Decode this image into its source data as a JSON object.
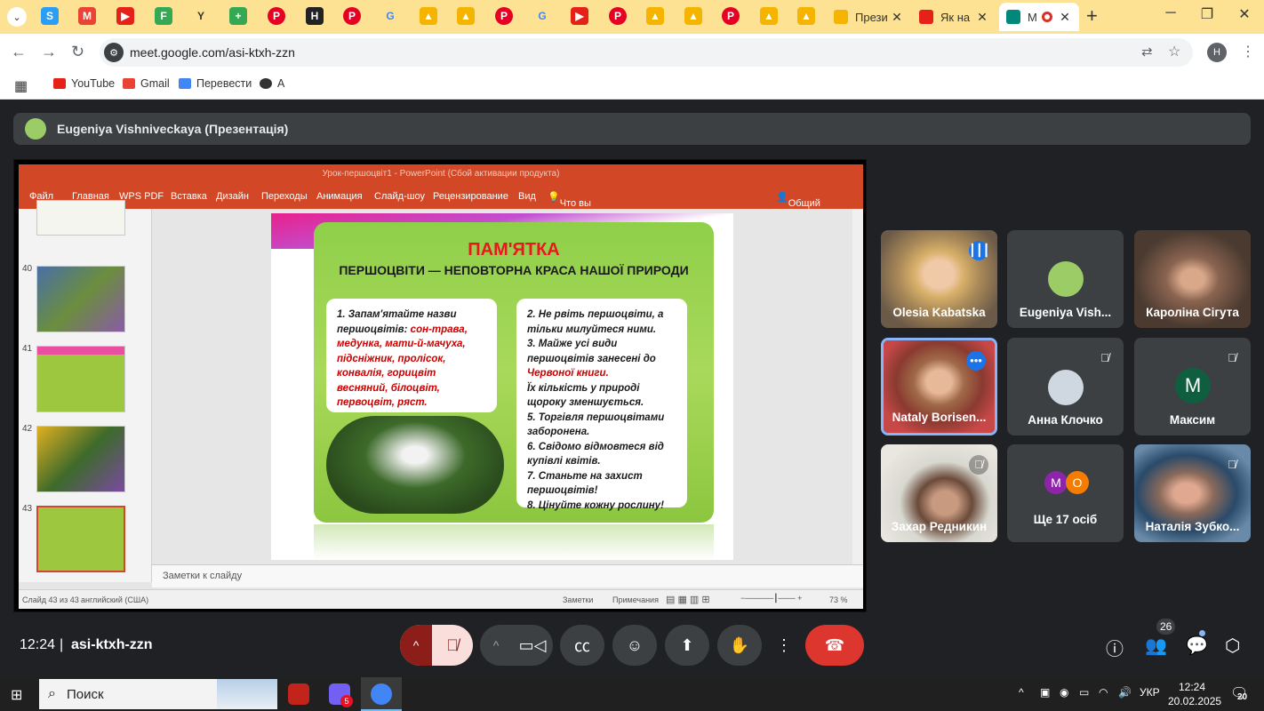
{
  "browser": {
    "tabs": [
      {
        "label": "Прези",
        "close": "✕"
      },
      {
        "label": "Як на",
        "close": "✕"
      },
      {
        "label": "M",
        "close": "✕"
      }
    ],
    "new_tab": "+",
    "url": "meet.google.com/asi-ktxh-zzn",
    "profile_initial": "H",
    "bookmarks": [
      "YouTube",
      "Gmail",
      "Перевести",
      "A"
    ]
  },
  "meet": {
    "presenter_label": "Eugeniya Vishniveckaya (Презентація)",
    "meeting_time": "12:24",
    "meeting_code": "asi-ktxh-zzn",
    "participants_count": "26",
    "participants": [
      {
        "name": "Olesia Kabatska",
        "muted": false,
        "speaking": true
      },
      {
        "name": "Eugeniya Vish...",
        "muted": false
      },
      {
        "name": "Кароліна Сігута",
        "muted": false
      },
      {
        "name": "Nataly Borisen...",
        "muted": false,
        "active": true
      },
      {
        "name": "Анна Клочко",
        "muted": true
      },
      {
        "name": "Максим",
        "muted": true,
        "initial": "M"
      },
      {
        "name": "Захар Редникин",
        "muted": true
      },
      {
        "name": "Ще 17 осіб",
        "initials": [
          "M",
          "O"
        ]
      },
      {
        "name": "Наталія Зубко...",
        "muted": true
      }
    ]
  },
  "ppt": {
    "title": "Урок-першоцвіт1 - PowerPoint (Сбой активации продукта)",
    "menu": [
      "Файл",
      "Главная",
      "WPS PDF",
      "Вставка",
      "Дизайн",
      "Переходы",
      "Анимация",
      "Слайд-шоу",
      "Рецензирование",
      "Вид",
      "Что вы хотите сделать?",
      "Общий доступ"
    ],
    "slide_numbers": [
      "40",
      "41",
      "42",
      "43"
    ],
    "notes_placeholder": "Заметки к слайду",
    "status_left": "Слайд 43 из 43",
    "status_lang": "английский (США)",
    "status_notes": "Заметки",
    "status_comments": "Примечания",
    "zoom": "73 %",
    "slide": {
      "title": "ПАМ'ЯТКА",
      "subtitle": "ПЕРШОЦВІТИ — НЕПОВТОРНА КРАСА НАШОЇ ПРИРОДИ",
      "left_intro": "1. Запам'ятайте назви першоцвітів:",
      "left_list": "сон-трава, медунка, мати-й-мачуха, підсніжник, пролісок, конвалія, горицвіт весняний, білоцвіт, первоцвіт, ряст.",
      "right_items": [
        "2. Не рвіть першоцвіти, а тільки милуйтеся ними.",
        "3. Майже усі види першоцвітів занесені до",
        "Червоної книги.",
        "Їх кількість у природі щороку зменшується.",
        "5. Торгівля першоцвітами заборонена.",
        "6. Свідомо відмовтеся від купівлі квітів.",
        "7. Станьте на захист першоцвітів!",
        "8. Цінуйте кожну рослину!"
      ]
    }
  },
  "taskbar": {
    "search_label": "Поиск",
    "lang": "УКР",
    "time": "12:24",
    "date": "20.02.2025",
    "notifications": "20",
    "viber_badge": "5"
  }
}
